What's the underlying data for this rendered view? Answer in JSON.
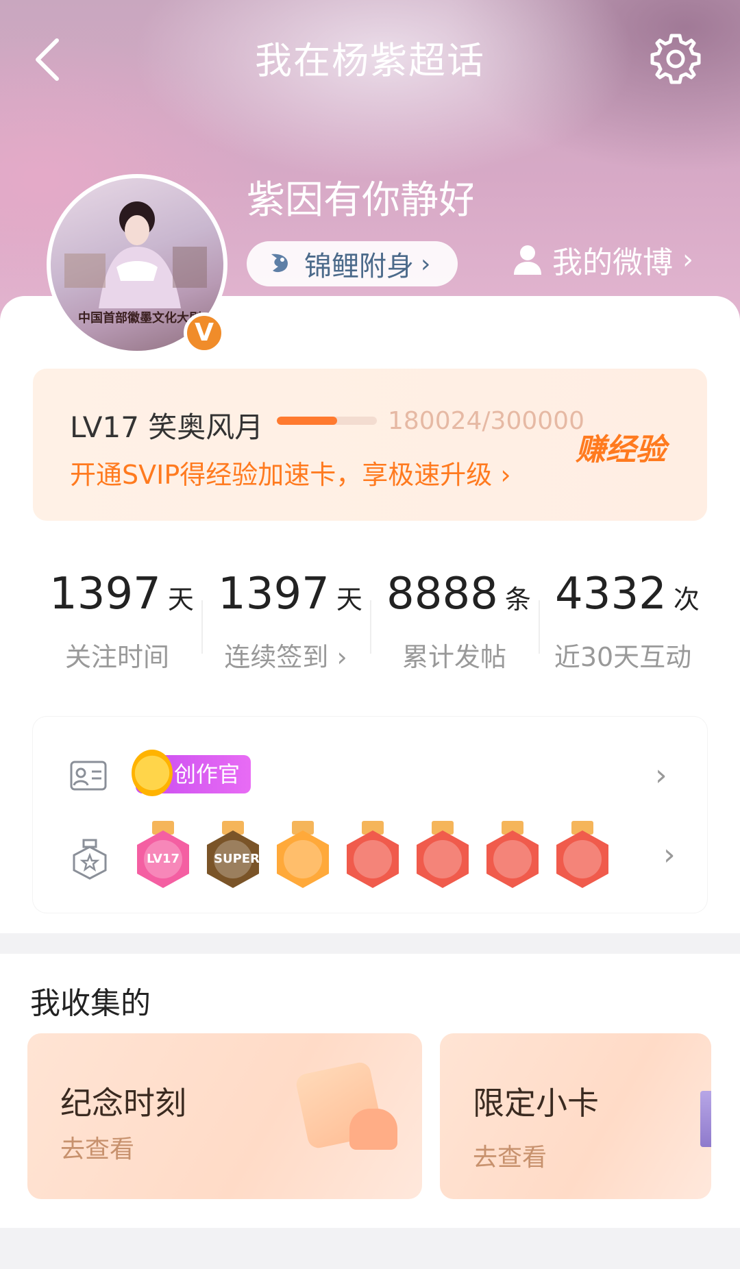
{
  "header": {
    "title": "我在杨紫超话",
    "back_icon": "back-arrow-icon",
    "settings_icon": "gear-icon"
  },
  "profile": {
    "username": "紫因有你静好",
    "koi_label": "锦鲤附身",
    "weibo_link": "我的微博",
    "avatar_caption": "中国首部徽墨文化大剧",
    "verified_badge": "V"
  },
  "level": {
    "name": "LV17 笑奥风月",
    "exp_text": "180024/300000",
    "progress": 0.6,
    "earn_label": "赚经验",
    "promo": "开通SVIP得经验加速卡，享极速升级"
  },
  "stats": [
    {
      "num": "1397",
      "unit": "天",
      "label": "关注时间"
    },
    {
      "num": "1397",
      "unit": "天",
      "label": "连续签到 ›"
    },
    {
      "num": "8888",
      "unit": "条",
      "label": "累计发帖"
    },
    {
      "num": "4332",
      "unit": "次",
      "label": "近30天互动"
    }
  ],
  "honors": {
    "creator_label": "创作官",
    "medals": [
      {
        "name": "LV17",
        "color": "#f45fa2"
      },
      {
        "name": "SUPER",
        "color": "#7a5428"
      },
      {
        "name": "",
        "color": "#ffa93a"
      },
      {
        "name": "",
        "color": "#f05b4c"
      },
      {
        "name": "",
        "color": "#f05b4c"
      },
      {
        "name": "",
        "color": "#f05b4c"
      },
      {
        "name": "",
        "color": "#f05b4c"
      }
    ]
  },
  "collection": {
    "title": "我收集的",
    "cards": [
      {
        "title": "纪念时刻",
        "sub": "去查看"
      },
      {
        "title": "限定小卡",
        "sub": "去查看"
      }
    ]
  },
  "colors": {
    "accent_orange": "#ff7a1f",
    "hero_pink": "#d7a9c6"
  }
}
